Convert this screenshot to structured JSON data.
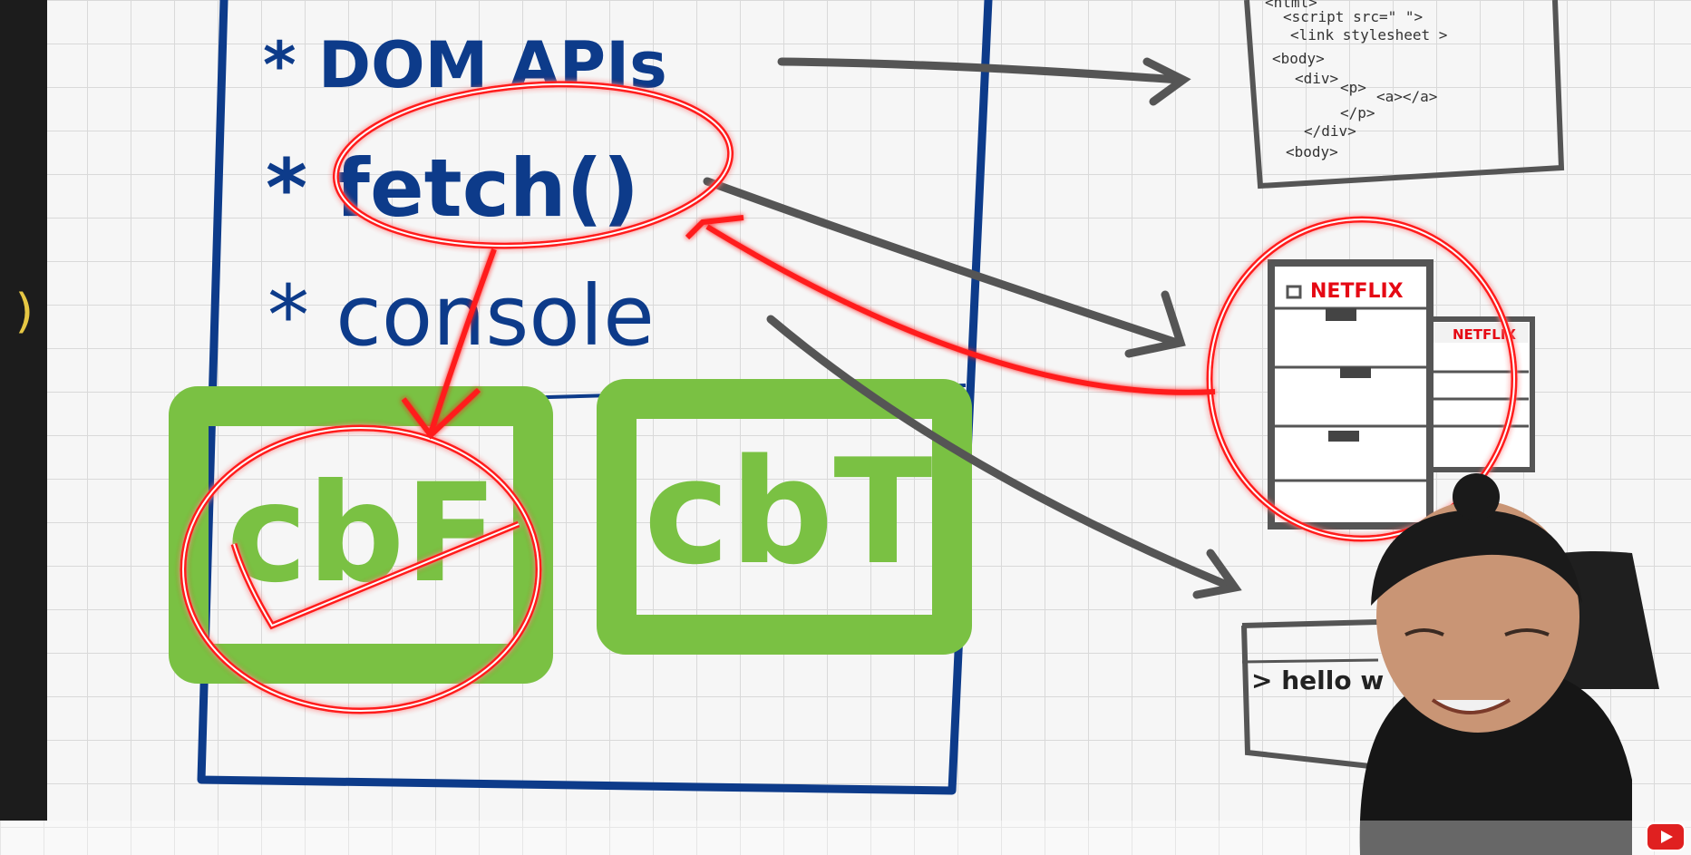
{
  "paren": ")",
  "runtime": {
    "items": [
      "* DOM APIs",
      "* fetch()",
      "* console"
    ]
  },
  "callbacks": {
    "left": "cbF",
    "right": "cbT"
  },
  "html_doc": {
    "lines": [
      "<html>",
      "<script src=\"  \">",
      "<link stylesheet >",
      "<body>",
      "<div>",
      "<p>",
      "<a></a>",
      "</p>",
      "</div>",
      "<body>"
    ]
  },
  "netflix": {
    "brand_primary": "NETFLIX",
    "brand_secondary": "NETFLIX",
    "color": "#e50914"
  },
  "console_panel": {
    "output": "> hello w"
  },
  "colors": {
    "ink_blue": "#0d3b8a",
    "green": "#7ac143",
    "red": "#ff1a1a",
    "arrow_gray": "#555555"
  },
  "icons": {
    "youtube": "youtube-icon",
    "presenter": "presenter-image"
  }
}
